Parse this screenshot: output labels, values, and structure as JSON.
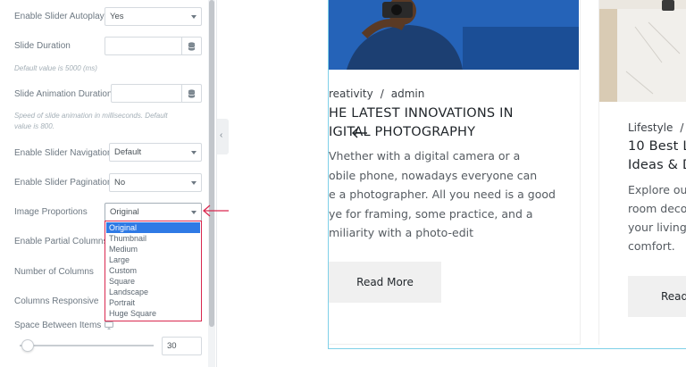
{
  "settings": {
    "autoplay": {
      "label": "Enable Slider Autoplay",
      "value": "Yes"
    },
    "slide_duration": {
      "label": "Slide Duration",
      "value": "",
      "help": "Default value is 5000 (ms)"
    },
    "slide_animation_duration": {
      "label": "Slide Animation Duration",
      "value": "",
      "help_line1": "Speed of slide animation in milliseconds. Default",
      "help_line2": "value is 800."
    },
    "navigation": {
      "label": "Enable Slider Navigation",
      "value": "Default"
    },
    "pagination": {
      "label": "Enable Slider Pagination",
      "value": "No"
    },
    "image_proportions": {
      "label": "Image Proportions",
      "value": "Original",
      "options": [
        "Original",
        "Thumbnail",
        "Medium",
        "Large",
        "Custom",
        "Square",
        "Landscape",
        "Portrait",
        "Huge Square"
      ],
      "selected_index": 0
    },
    "partial_columns": {
      "label": "Enable Partial Columns"
    },
    "number_of_columns": {
      "label": "Number of Columns"
    },
    "columns_responsive": {
      "label": "Columns Responsive"
    },
    "space_between_items": {
      "label": "Space Between Items",
      "value": "30",
      "slider_fraction": 0.06
    }
  },
  "preview": {
    "card1": {
      "category": "reativity",
      "separator": "/",
      "author": "admin",
      "title_line1": "HE LATEST INNOVATIONS IN",
      "title_line2": "IGITAL PHOTOGRAPHY",
      "excerpt": [
        "Vhether with a digital camera or a",
        "obile phone, nowadays everyone can",
        "e a photographer. All you need is a good",
        "ye for framing, some practice, and a",
        "miliarity with a photo-edit"
      ],
      "button": "Read More"
    },
    "card2": {
      "category": "Lifestyle",
      "separator": "/",
      "title_line1": "10 Best L",
      "title_line2": "Ideas & D",
      "excerpt": [
        "Explore ou",
        "room deco",
        "your living",
        "comfort."
      ],
      "button": "Read"
    }
  },
  "colors": {
    "accent_border": "#d9284f",
    "option_selected": "#2f7ae5",
    "frame_border": "#7ed0e8"
  },
  "icons": {
    "number_stepper": "database-stack-icon",
    "collapse": "chevron-left-icon",
    "pointer": "arrow-left-icon",
    "responsive": "monitor-icon"
  }
}
